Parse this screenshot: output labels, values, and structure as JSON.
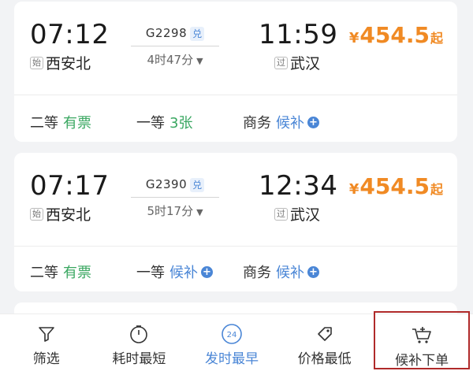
{
  "trains": [
    {
      "departure_time": "07:12",
      "departure_station_tag": "始",
      "departure_station": "西安北",
      "train_number": "G2298",
      "train_badge": "兑",
      "duration": "4时47分",
      "arrival_time": "11:59",
      "arrival_station_tag": "过",
      "arrival_station": "武汉",
      "price_symbol": "¥",
      "price": "454.5",
      "price_suffix": "起",
      "seats": [
        {
          "name": "二等",
          "value": "有票",
          "state": "available"
        },
        {
          "name": "一等",
          "value": "3张",
          "state": "available"
        },
        {
          "name": "商务",
          "value": "候补",
          "state": "waitlist"
        }
      ]
    },
    {
      "departure_time": "07:17",
      "departure_station_tag": "始",
      "departure_station": "西安北",
      "train_number": "G2390",
      "train_badge": "兑",
      "duration": "5时17分",
      "arrival_time": "12:34",
      "arrival_station_tag": "过",
      "arrival_station": "武汉",
      "price_symbol": "¥",
      "price": "454.5",
      "price_suffix": "起",
      "seats": [
        {
          "name": "二等",
          "value": "有票",
          "state": "available"
        },
        {
          "name": "一等",
          "value": "候补",
          "state": "waitlist"
        },
        {
          "name": "商务",
          "value": "候补",
          "state": "waitlist"
        }
      ]
    }
  ],
  "bottom_bar": {
    "tabs": [
      {
        "label": "筛选",
        "icon": "filter-icon"
      },
      {
        "label": "耗时最短",
        "icon": "timer-icon"
      },
      {
        "label": "发时最早",
        "icon": "clock-24-icon",
        "badge": "24",
        "active": true
      },
      {
        "label": "价格最低",
        "icon": "price-tag-icon"
      },
      {
        "label": "候补下单",
        "icon": "cart-add-icon",
        "highlighted": true
      }
    ]
  },
  "colors": {
    "accent_blue": "#4a86d6",
    "available_green": "#3aa761",
    "price_orange": "#f08a24",
    "highlight_border": "#b02a2a"
  }
}
